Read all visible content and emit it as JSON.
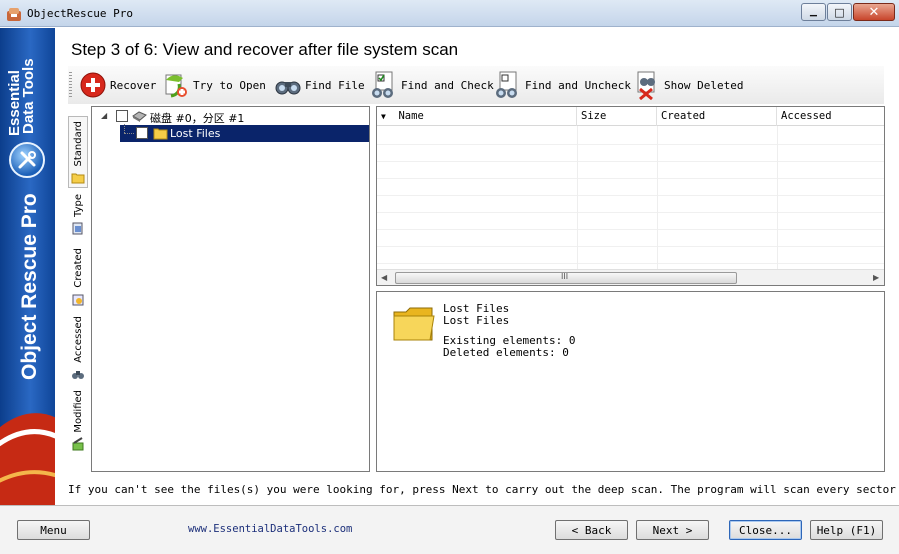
{
  "window": {
    "title": "ObjectRescue Pro",
    "controls": {
      "minimize": "▭",
      "maximize": "□",
      "close": "✕"
    }
  },
  "banner": {
    "company_line1": "Essential",
    "company_line2": "Data Tools",
    "product": "Object Rescue Pro"
  },
  "step_title": "Step 3 of 6: View and recover after file system scan",
  "toolbar": {
    "recover": "Recover",
    "try_to_open": "Try to Open",
    "find_file": "Find File",
    "find_and_check": "Find and Check",
    "find_and_uncheck": "Find and Uncheck",
    "show_deleted": "Show Deleted"
  },
  "tabs": [
    "Standard",
    "Type",
    "Created",
    "Accessed",
    "Modified"
  ],
  "tree": {
    "root": "磁盘 #0，分区 #1",
    "child": "Lost Files"
  },
  "list": {
    "columns": [
      "Name",
      "Size",
      "Created",
      "Accessed"
    ],
    "scroll_grip": "III"
  },
  "details": {
    "name": "Lost Files",
    "path": "Lost Files",
    "existing": "Existing elements: 0",
    "deleted": "Deleted elements: 0"
  },
  "hint": "If you can't see the files(s) you were looking for, press Next to carry out the deep scan. The program will scan every sector on your drive",
  "footer": {
    "menu": "Menu",
    "website": "www.EssentialDataTools.com",
    "back": "< Back",
    "next": "Next >",
    "close": "Close...",
    "help": "Help (F1)"
  }
}
